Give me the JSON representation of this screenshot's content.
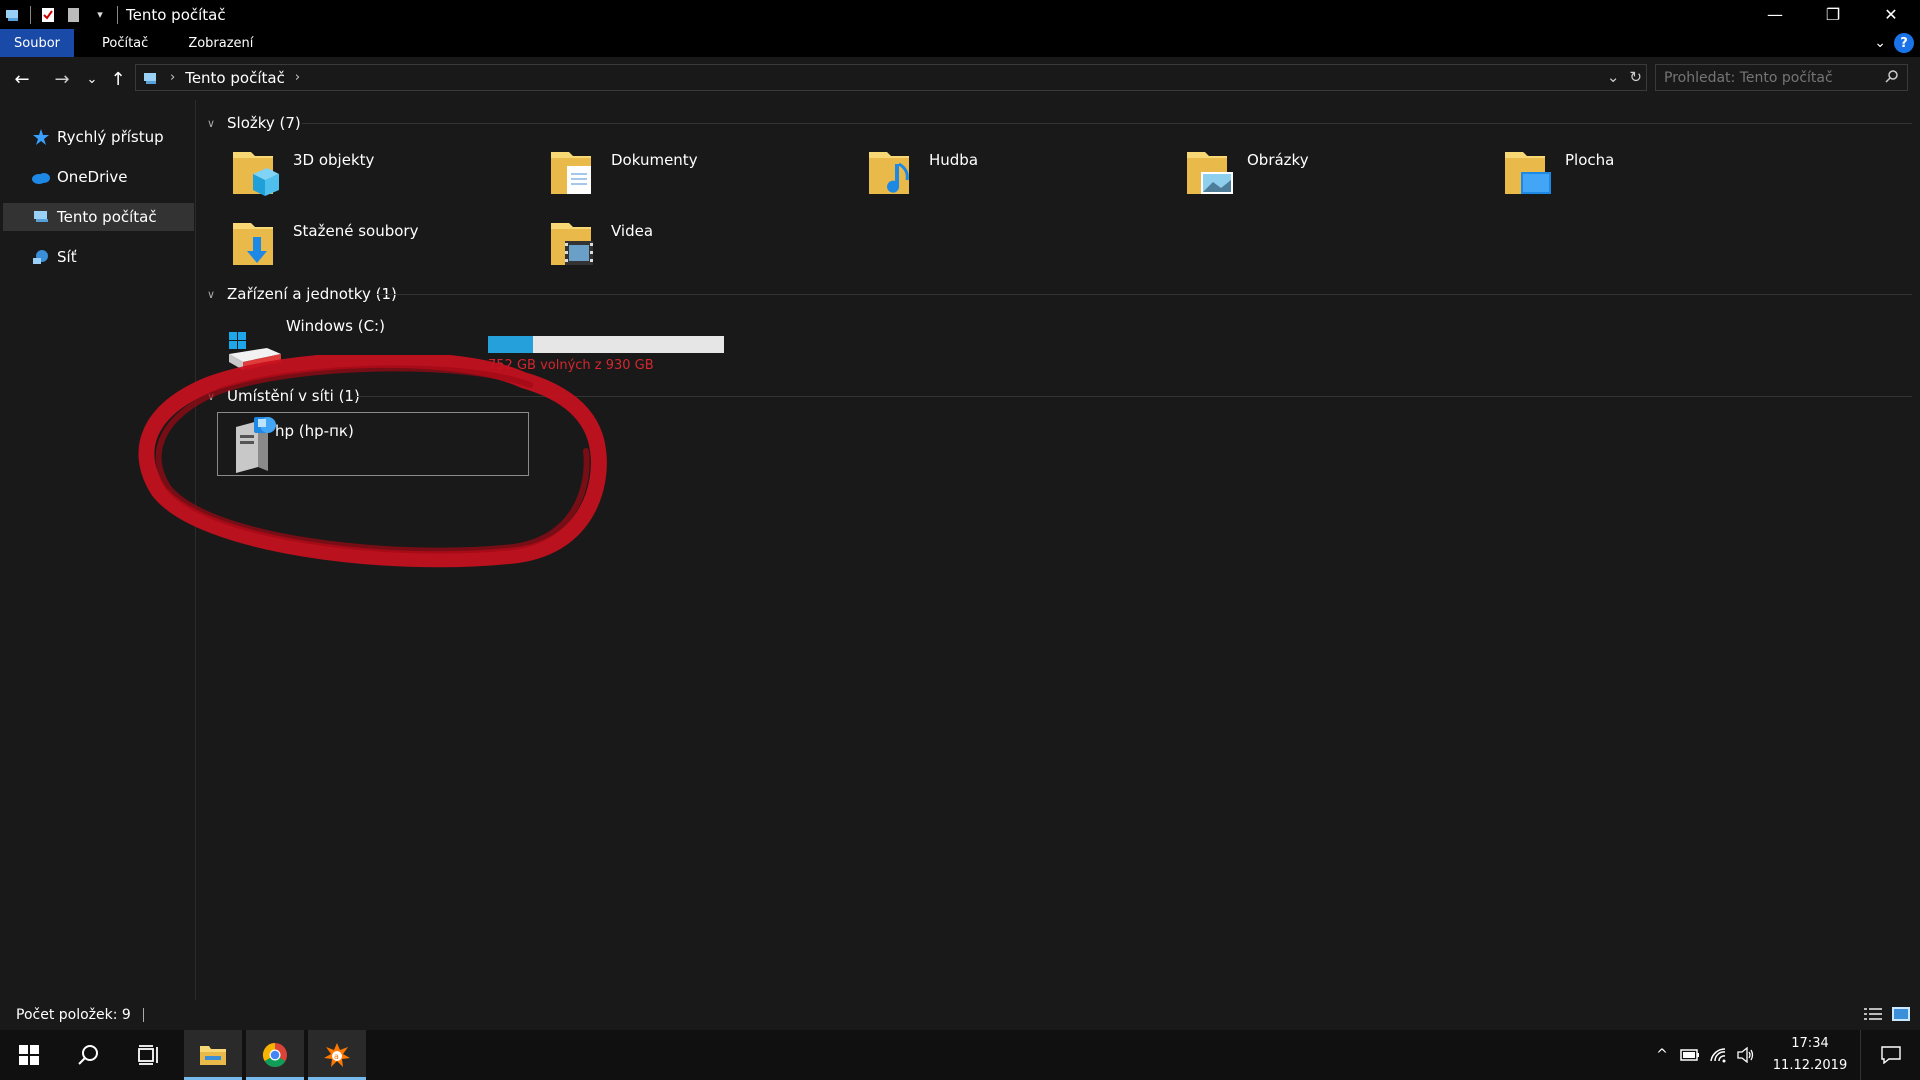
{
  "window": {
    "title": "Tento počítač",
    "controls": {
      "minimize": "—",
      "restore": "❐",
      "close": "✕"
    }
  },
  "ribbon": {
    "tabs": [
      {
        "label": "Soubor",
        "active": true
      },
      {
        "label": "Počítač",
        "active": false
      },
      {
        "label": "Zobrazení",
        "active": false
      }
    ],
    "help": "?"
  },
  "nav": {
    "back": "←",
    "forward": "→",
    "recent": "⌄",
    "up": "↑",
    "breadcrumb": "Tento počítač",
    "search_placeholder": "Prohledat: Tento počítač"
  },
  "sidebar": {
    "items": [
      {
        "label": "Rychlý přístup",
        "icon": "star-icon"
      },
      {
        "label": "OneDrive",
        "icon": "cloud-icon"
      },
      {
        "label": "Tento počítač",
        "icon": "computer-icon",
        "selected": true
      },
      {
        "label": "Síť",
        "icon": "network-icon"
      }
    ]
  },
  "groups": {
    "folders": {
      "header": "Složky (7)",
      "items": [
        {
          "label": "3D objekty",
          "icon": "3d-objects-folder-icon"
        },
        {
          "label": "Dokumenty",
          "icon": "documents-folder-icon"
        },
        {
          "label": "Hudba",
          "icon": "music-folder-icon"
        },
        {
          "label": "Obrázky",
          "icon": "pictures-folder-icon"
        },
        {
          "label": "Plocha",
          "icon": "desktop-folder-icon"
        },
        {
          "label": "Stažené soubory",
          "icon": "downloads-folder-icon"
        },
        {
          "label": "Videa",
          "icon": "videos-folder-icon"
        }
      ]
    },
    "devices": {
      "header": "Zařízení a jednotky (1)",
      "drive": {
        "label": "Windows (C:)",
        "info": "752 GB volných z 930 GB",
        "used_fraction": 0.19,
        "icon": "windows-drive-icon"
      }
    },
    "network": {
      "header": "Umístění v síti (1)",
      "items": [
        {
          "label": "hp (hp-пк)",
          "icon": "network-drive-icon"
        }
      ]
    }
  },
  "status": {
    "item_count": "Počet položek: 9"
  },
  "taskbar": {
    "time": "17:34",
    "date": "11.12.2019"
  },
  "colors": {
    "accent": "#1a4aa8",
    "drive_fill": "#26a0da",
    "drive_info": "#d4262f",
    "annotation": "#c8101e",
    "folder_yellow": "#f8d775"
  }
}
